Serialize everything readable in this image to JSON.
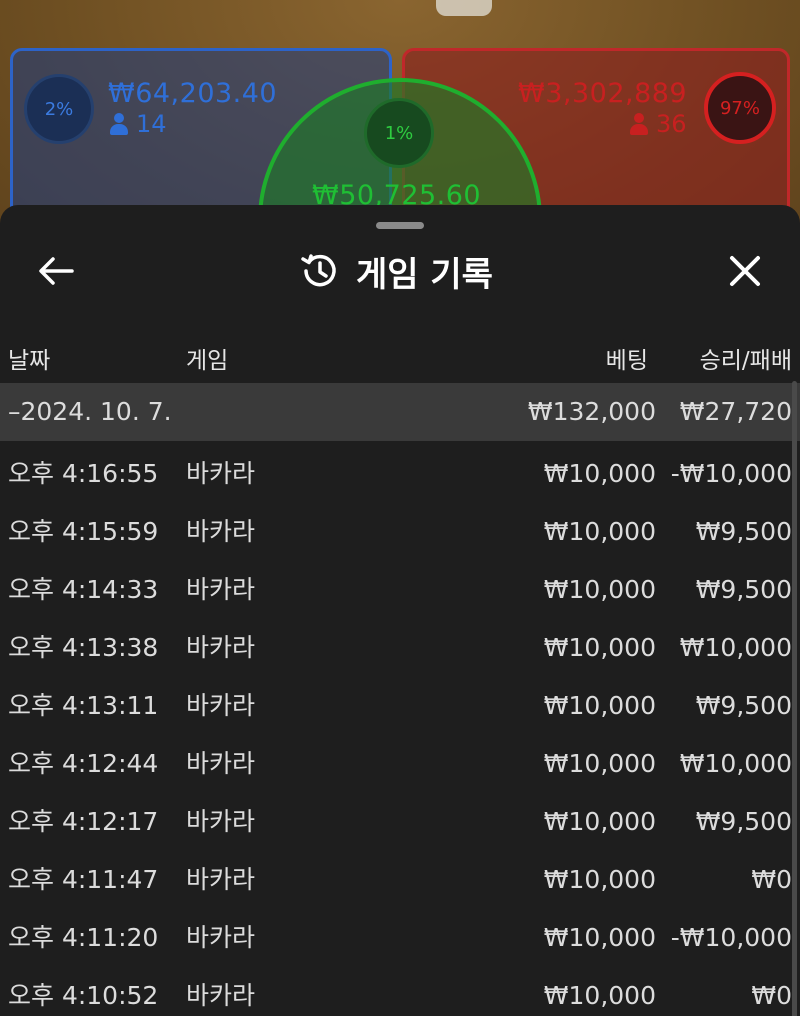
{
  "table": {
    "player": {
      "percent": "2%",
      "amount": "₩64,203.40",
      "count": "14"
    },
    "tie": {
      "percent": "1%",
      "amount": "₩50,725.60"
    },
    "banker": {
      "percent": "97%",
      "amount": "₩3,302,889",
      "count": "36"
    },
    "colors": {
      "player": "#2f6fd8",
      "tie": "#1fbf34",
      "banker": "#c82020"
    }
  },
  "sheet": {
    "title": "게임 기록",
    "icons": {
      "back": "arrow-left-icon",
      "history": "history-icon",
      "close": "close-icon"
    },
    "columns": {
      "date": "날짜",
      "game": "게임",
      "bet": "베팅",
      "winloss": "승리/패배"
    },
    "date_group": {
      "date": "–2024. 10. 7.",
      "total_bet": "₩132,000",
      "total_winloss": "₩27,720"
    },
    "rows": [
      {
        "time": "오후 4:16:55",
        "game": "바카라",
        "bet": "₩10,000",
        "winloss": "-₩10,000"
      },
      {
        "time": "오후 4:15:59",
        "game": "바카라",
        "bet": "₩10,000",
        "winloss": "₩9,500"
      },
      {
        "time": "오후 4:14:33",
        "game": "바카라",
        "bet": "₩10,000",
        "winloss": "₩9,500"
      },
      {
        "time": "오후 4:13:38",
        "game": "바카라",
        "bet": "₩10,000",
        "winloss": "₩10,000"
      },
      {
        "time": "오후 4:13:11",
        "game": "바카라",
        "bet": "₩10,000",
        "winloss": "₩9,500"
      },
      {
        "time": "오후 4:12:44",
        "game": "바카라",
        "bet": "₩10,000",
        "winloss": "₩10,000"
      },
      {
        "time": "오후 4:12:17",
        "game": "바카라",
        "bet": "₩10,000",
        "winloss": "₩9,500"
      },
      {
        "time": "오후 4:11:47",
        "game": "바카라",
        "bet": "₩10,000",
        "winloss": "₩0"
      },
      {
        "time": "오후 4:11:20",
        "game": "바카라",
        "bet": "₩10,000",
        "winloss": "-₩10,000"
      },
      {
        "time": "오후 4:10:52",
        "game": "바카라",
        "bet": "₩10,000",
        "winloss": "₩0"
      }
    ]
  }
}
